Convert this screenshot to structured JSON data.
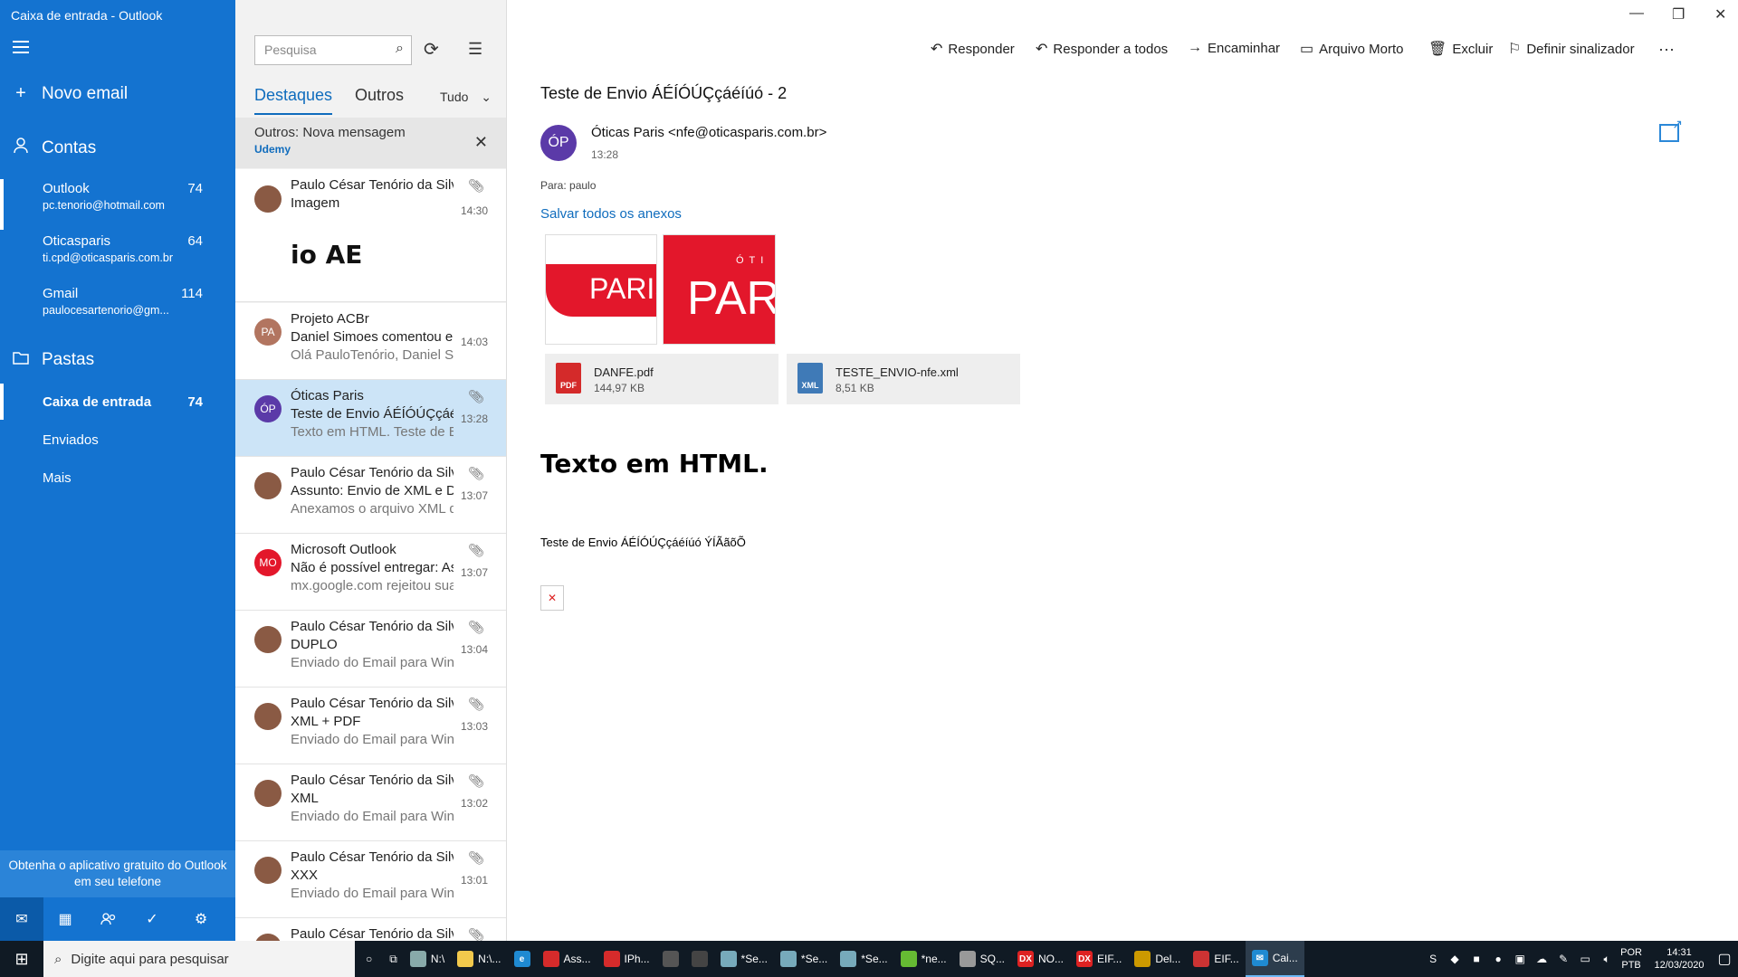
{
  "window_title": "Caixa de entrada - Outlook",
  "sidebar": {
    "new_mail": "Novo email",
    "accounts_label": "Contas",
    "accounts": [
      {
        "name": "Outlook",
        "email": "pc.tenorio@hotmail.com",
        "count": "74"
      },
      {
        "name": "Oticasparis",
        "email": "ti.cpd@oticasparis.com.br",
        "count": "64"
      },
      {
        "name": "Gmail",
        "email": "paulocesartenorio@gm...",
        "count": "114"
      }
    ],
    "folders_label": "Pastas",
    "folders": [
      {
        "name": "Caixa de entrada",
        "count": "74"
      },
      {
        "name": "Enviados",
        "count": ""
      },
      {
        "name": "Mais",
        "count": ""
      }
    ],
    "promo": "Obtenha o aplicativo gratuito do Outlook em seu telefone"
  },
  "list": {
    "search_placeholder": "Pesquisa",
    "tab_focused": "Destaques",
    "tab_other": "Outros",
    "filter": "Tudo",
    "notice_title": "Outros: Nova mensagem",
    "notice_sender": "Udemy",
    "messages": [
      {
        "from": "Paulo César Tenório da Silva",
        "subject": "Imagem",
        "preview": "",
        "time": "14:30",
        "initials": "",
        "image_text": "io AE"
      },
      {
        "from": "Projeto ACBr",
        "subject": "Daniel Simoes comentou em",
        "preview": "Olá PauloTenório, Daniel Simoes",
        "time": "14:03",
        "initials": "PA"
      },
      {
        "from": "Óticas Paris",
        "subject": "Teste de Envio ÁÉÍÓÚÇçáéíúó",
        "preview": "Texto em HTML. Teste de Envio",
        "time": "13:28",
        "initials": "ÓP"
      },
      {
        "from": "Paulo César Tenório da Silva",
        "subject": "Assunto: Envio de XML e DANFE",
        "preview": "Anexamos o arquivo XML da",
        "time": "13:07",
        "initials": ""
      },
      {
        "from": "Microsoft Outlook",
        "subject": "Não é possível entregar: Assunto",
        "preview": "mx.google.com rejeitou sua",
        "time": "13:07",
        "initials": "MO"
      },
      {
        "from": "Paulo César Tenório da Silva",
        "subject": "DUPLO",
        "preview": "Enviado do Email para Windows",
        "time": "13:04",
        "initials": ""
      },
      {
        "from": "Paulo César Tenório da Silva",
        "subject": "XML + PDF",
        "preview": "Enviado do Email para Windows",
        "time": "13:03",
        "initials": ""
      },
      {
        "from": "Paulo César Tenório da Silva",
        "subject": "XML",
        "preview": "Enviado do Email para Windows",
        "time": "13:02",
        "initials": ""
      },
      {
        "from": "Paulo César Tenório da Silva",
        "subject": "XXX",
        "preview": "Enviado do Email para Windows",
        "time": "13:01",
        "initials": ""
      },
      {
        "from": "Paulo César Tenório da Silva",
        "subject": "",
        "preview": "",
        "time": "",
        "initials": ""
      }
    ]
  },
  "toolbar": {
    "reply": "Responder",
    "reply_all": "Responder a todos",
    "forward": "Encaminhar",
    "archive": "Arquivo Morto",
    "delete": "Excluir",
    "flag": "Definir sinalizador",
    "more": "···"
  },
  "message": {
    "subject": "Teste de Envio ÁÉÍÓÚÇçáéíúó - 2",
    "sender_initials": "ÓP",
    "sender": "Óticas Paris <nfe@oticasparis.com.br>",
    "time": "13:28",
    "to_label": "Para:",
    "to": "paulo",
    "save_all": "Salvar todos os anexos",
    "thumb1_text": "PARIS",
    "thumb2_small": "ÓTI",
    "thumb2_big": "PAR",
    "attachments": [
      {
        "name": "DANFE.pdf",
        "size": "144,97 KB",
        "icon": "PDF"
      },
      {
        "name": "TESTE_ENVIO-nfe.xml",
        "size": "8,51 KB",
        "icon": "XML"
      }
    ],
    "body_heading": "Texto em HTML.",
    "body_text": "Teste de Envio ÁÉÍÓÚÇçáéíúó ÝÍÃãõÕ"
  },
  "taskbar": {
    "search_placeholder": "Digite aqui para pesquisar",
    "tasks": [
      {
        "label": "N:\\",
        "icon": "drive"
      },
      {
        "label": "N:\\...",
        "icon": "folder"
      },
      {
        "label": "",
        "icon": "edge"
      },
      {
        "label": "Ass...",
        "icon": "app"
      },
      {
        "label": "IPh...",
        "icon": "app"
      },
      {
        "label": "",
        "icon": "store"
      },
      {
        "label": "",
        "icon": "calc"
      },
      {
        "label": "*Se...",
        "icon": "note"
      },
      {
        "label": "*Se...",
        "icon": "note"
      },
      {
        "label": "*Se...",
        "icon": "note"
      },
      {
        "label": "*ne...",
        "icon": "notepad"
      },
      {
        "label": "SQ...",
        "icon": "sql"
      },
      {
        "label": "NO...",
        "icon": "DX"
      },
      {
        "label": "EIF...",
        "icon": "DX"
      },
      {
        "label": "Del...",
        "icon": "delphi"
      },
      {
        "label": "EIF...",
        "icon": "app"
      },
      {
        "label": "Cai...",
        "icon": "mail"
      }
    ],
    "lang_1": "POR",
    "lang_2": "PTB",
    "time": "14:31",
    "date": "12/03/2020"
  }
}
